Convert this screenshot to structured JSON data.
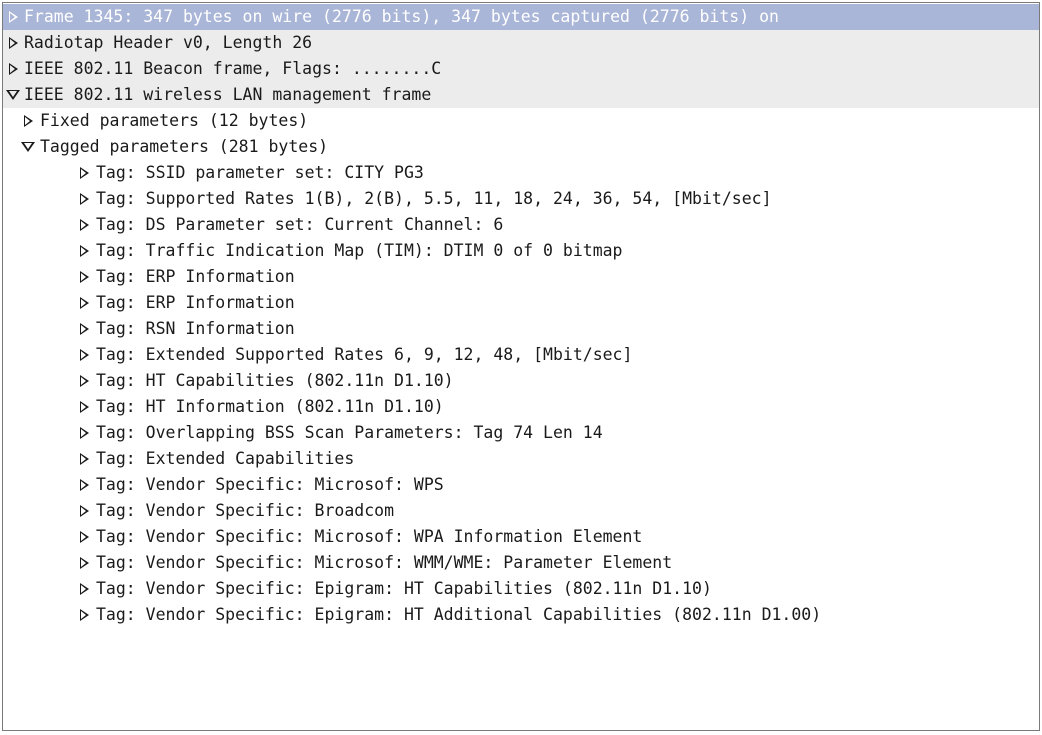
{
  "colors": {
    "selected_row": "#aab6d8",
    "top_level_row": "#ececec",
    "text": "#1a1a1a"
  },
  "tree": {
    "rows": [
      {
        "label": "Frame 1345: 347 bytes on wire (2776 bits), 347 bytes captured (2776 bits) on",
        "level": 1,
        "state": "collapsed",
        "selected": true
      },
      {
        "label": "Radiotap Header v0, Length 26",
        "level": 1,
        "state": "collapsed"
      },
      {
        "label": "IEEE 802.11 Beacon frame, Flags: ........C",
        "level": 1,
        "state": "collapsed"
      },
      {
        "label": "IEEE 802.11 wireless LAN management frame",
        "level": 1,
        "state": "expanded"
      },
      {
        "label": "Fixed parameters (12 bytes)",
        "level": 2,
        "state": "collapsed"
      },
      {
        "label": "Tagged parameters (281 bytes)",
        "level": 2,
        "state": "expanded"
      },
      {
        "label": "Tag: SSID parameter set: CITY PG3",
        "level": 3,
        "state": "collapsed"
      },
      {
        "label": "Tag: Supported Rates 1(B), 2(B), 5.5, 11, 18, 24, 36, 54, [Mbit/sec]",
        "level": 3,
        "state": "collapsed"
      },
      {
        "label": "Tag: DS Parameter set: Current Channel: 6",
        "level": 3,
        "state": "collapsed"
      },
      {
        "label": "Tag: Traffic Indication Map (TIM): DTIM 0 of 0 bitmap",
        "level": 3,
        "state": "collapsed"
      },
      {
        "label": "Tag: ERP Information",
        "level": 3,
        "state": "collapsed"
      },
      {
        "label": "Tag: ERP Information",
        "level": 3,
        "state": "collapsed"
      },
      {
        "label": "Tag: RSN Information",
        "level": 3,
        "state": "collapsed"
      },
      {
        "label": "Tag: Extended Supported Rates 6, 9, 12, 48, [Mbit/sec]",
        "level": 3,
        "state": "collapsed"
      },
      {
        "label": "Tag: HT Capabilities (802.11n D1.10)",
        "level": 3,
        "state": "collapsed"
      },
      {
        "label": "Tag: HT Information (802.11n D1.10)",
        "level": 3,
        "state": "collapsed"
      },
      {
        "label": "Tag: Overlapping BSS Scan Parameters: Tag 74 Len 14",
        "level": 3,
        "state": "collapsed"
      },
      {
        "label": "Tag: Extended Capabilities",
        "level": 3,
        "state": "collapsed"
      },
      {
        "label": "Tag: Vendor Specific: Microsof: WPS",
        "level": 3,
        "state": "collapsed"
      },
      {
        "label": "Tag: Vendor Specific: Broadcom",
        "level": 3,
        "state": "collapsed"
      },
      {
        "label": "Tag: Vendor Specific: Microsof: WPA Information Element",
        "level": 3,
        "state": "collapsed"
      },
      {
        "label": "Tag: Vendor Specific: Microsof: WMM/WME: Parameter Element",
        "level": 3,
        "state": "collapsed"
      },
      {
        "label": "Tag: Vendor Specific: Epigram: HT Capabilities (802.11n D1.10)",
        "level": 3,
        "state": "collapsed"
      },
      {
        "label": "Tag: Vendor Specific: Epigram: HT Additional Capabilities (802.11n D1.00)",
        "level": 3,
        "state": "collapsed"
      }
    ]
  }
}
